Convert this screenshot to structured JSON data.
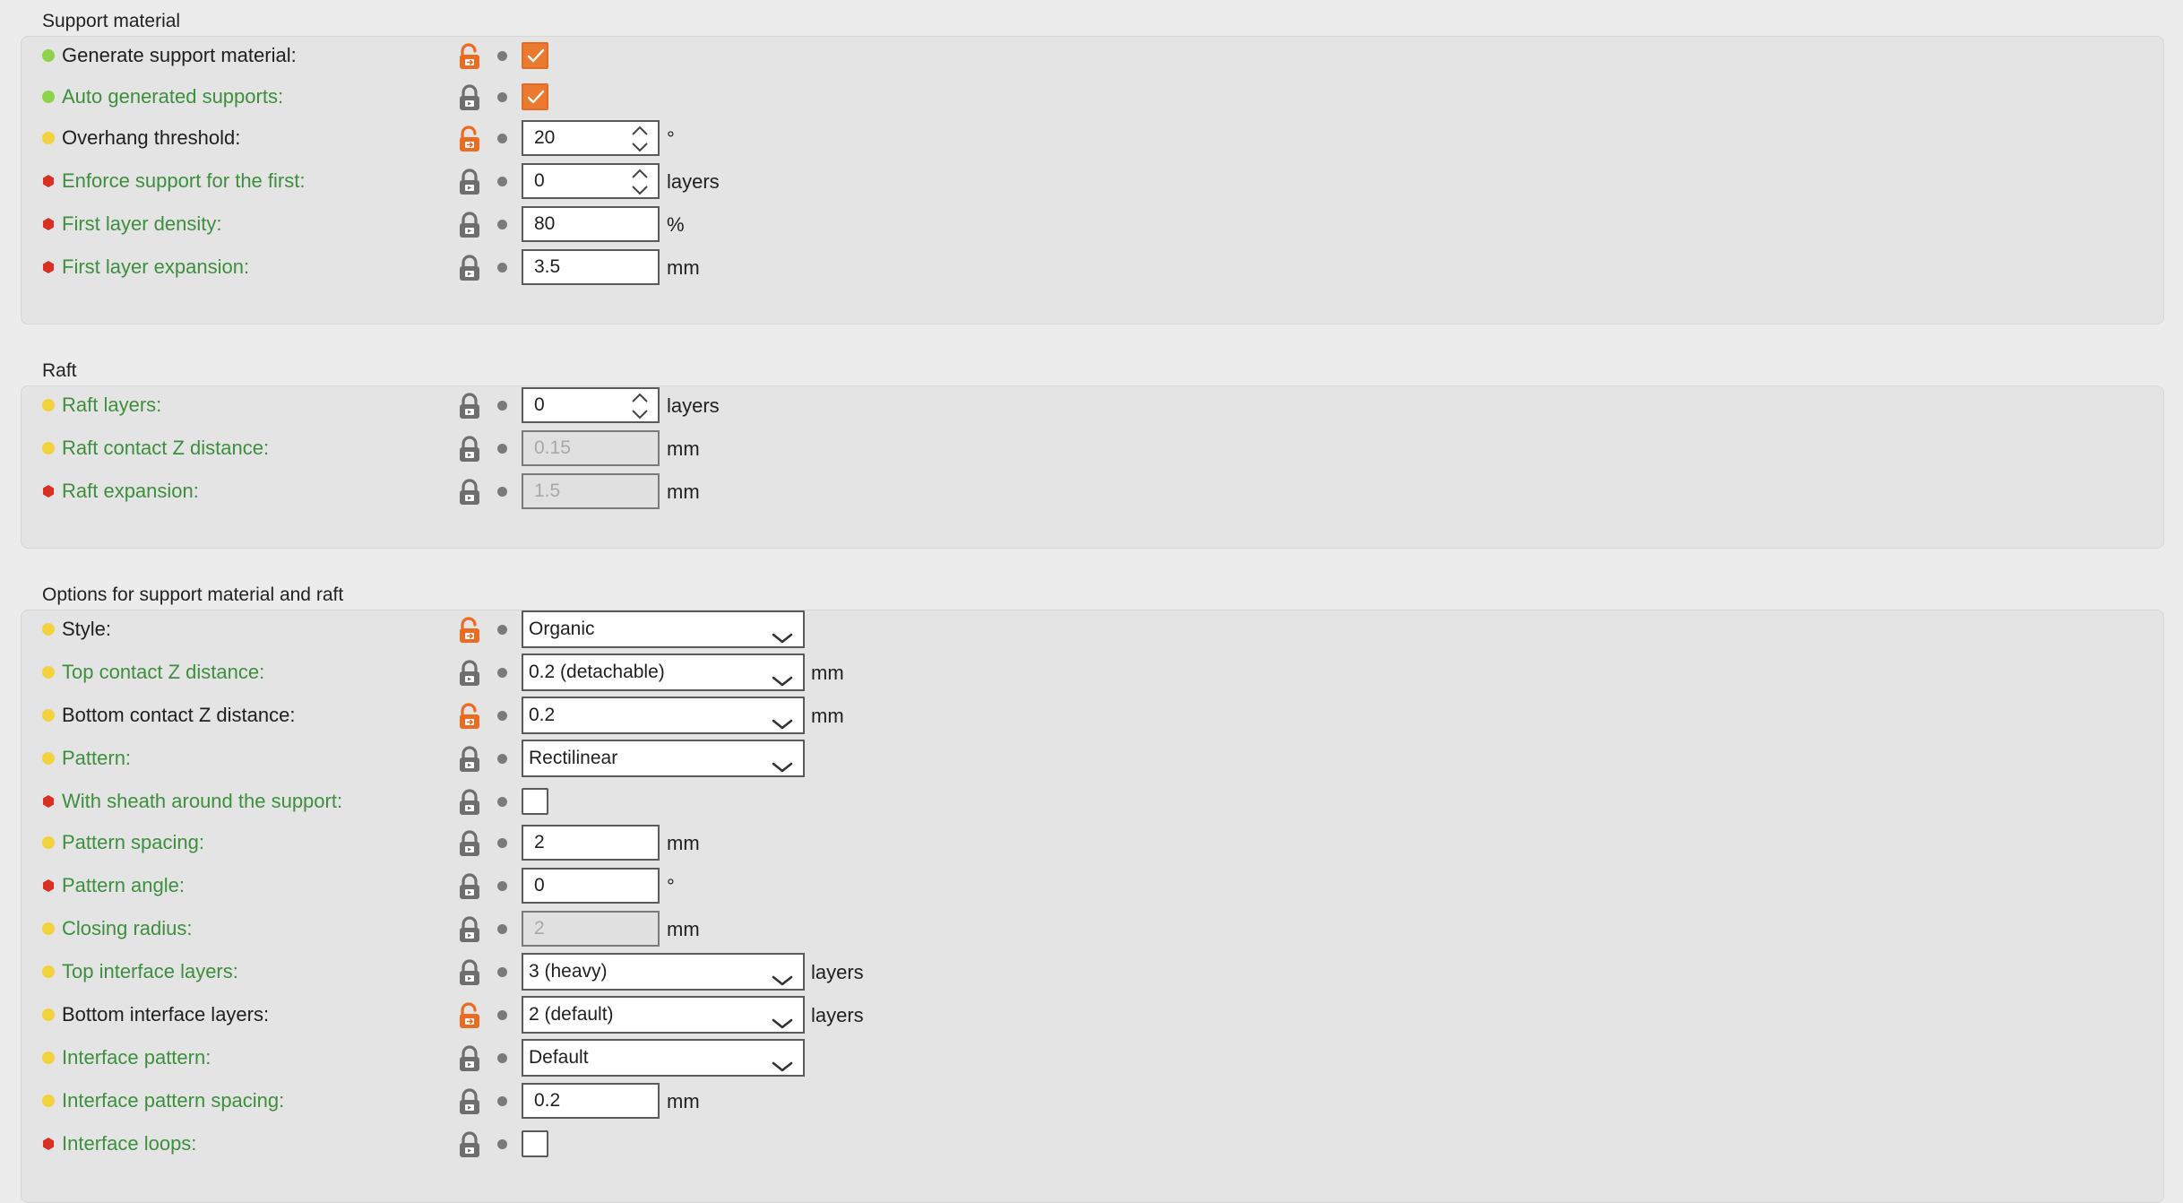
{
  "colors": {
    "accent": "#ea7a30",
    "mode_simple": "#8dd44a",
    "mode_advanced": "#f2d23d",
    "mode_expert": "#d93024",
    "system_value_label": "#3d8f3d"
  },
  "groups": [
    {
      "title": "Support material",
      "rows": [
        {
          "label": "Generate support material:",
          "mode": "simple",
          "lock": "unlocked-lock-icon",
          "control": "checkbox",
          "checked": true
        },
        {
          "label": "Auto generated supports:",
          "mode": "simple",
          "lock": "locked-lock-icon",
          "control": "checkbox",
          "checked": true
        },
        {
          "label": "Overhang threshold:",
          "mode": "advanced",
          "lock": "unlocked-lock-icon",
          "control": "spin",
          "value": "20",
          "unit": "°"
        },
        {
          "label": "Enforce support for the first:",
          "mode": "expert",
          "lock": "locked-lock-icon",
          "control": "spin",
          "value": "0",
          "unit": "layers"
        },
        {
          "label": "First layer density:",
          "mode": "expert",
          "lock": "locked-lock-icon",
          "control": "text",
          "value": "80",
          "unit": "%"
        },
        {
          "label": "First layer expansion:",
          "mode": "expert",
          "lock": "locked-lock-icon",
          "control": "text",
          "value": "3.5",
          "unit": "mm"
        }
      ]
    },
    {
      "title": "Raft",
      "rows": [
        {
          "label": "Raft layers:",
          "mode": "advanced",
          "lock": "locked-lock-icon",
          "control": "spin",
          "value": "0",
          "unit": "layers"
        },
        {
          "label": "Raft contact Z distance:",
          "mode": "advanced",
          "lock": "locked-lock-icon",
          "control": "text",
          "value": "0.15",
          "unit": "mm",
          "disabled": true
        },
        {
          "label": "Raft expansion:",
          "mode": "expert",
          "lock": "locked-lock-icon",
          "control": "text",
          "value": "1.5",
          "unit": "mm",
          "disabled": true
        }
      ]
    },
    {
      "title": "Options for support material and raft",
      "rows": [
        {
          "label": "Style:",
          "mode": "advanced",
          "lock": "unlocked-lock-icon",
          "control": "select",
          "value": "Organic"
        },
        {
          "label": "Top contact Z distance:",
          "mode": "advanced",
          "lock": "locked-lock-icon",
          "control": "select",
          "value": "0.2 (detachable)",
          "unit": "mm"
        },
        {
          "label": "Bottom contact Z distance:",
          "mode": "advanced",
          "lock": "unlocked-lock-icon",
          "control": "select",
          "value": "0.2",
          "unit": "mm"
        },
        {
          "label": "Pattern:",
          "mode": "advanced",
          "lock": "locked-lock-icon",
          "control": "select",
          "value": "Rectilinear"
        },
        {
          "label": "With sheath around the support:",
          "mode": "expert",
          "lock": "locked-lock-icon",
          "control": "checkbox",
          "checked": false
        },
        {
          "label": "Pattern spacing:",
          "mode": "advanced",
          "lock": "locked-lock-icon",
          "control": "text",
          "value": "2",
          "unit": "mm"
        },
        {
          "label": "Pattern angle:",
          "mode": "expert",
          "lock": "locked-lock-icon",
          "control": "text",
          "value": "0",
          "unit": "°"
        },
        {
          "label": "Closing radius:",
          "mode": "advanced",
          "lock": "locked-lock-icon",
          "control": "text",
          "value": "2",
          "unit": "mm",
          "disabled": true
        },
        {
          "label": "Top interface layers:",
          "mode": "advanced",
          "lock": "locked-lock-icon",
          "control": "select",
          "value": "3 (heavy)",
          "unit": "layers"
        },
        {
          "label": "Bottom interface layers:",
          "mode": "advanced",
          "lock": "unlocked-lock-icon",
          "control": "select",
          "value": "2 (default)",
          "unit": "layers"
        },
        {
          "label": "Interface pattern:",
          "mode": "advanced",
          "lock": "locked-lock-icon",
          "control": "select",
          "value": "Default"
        },
        {
          "label": "Interface pattern spacing:",
          "mode": "advanced",
          "lock": "locked-lock-icon",
          "control": "text",
          "value": "0.2",
          "unit": "mm"
        },
        {
          "label": "Interface loops:",
          "mode": "expert",
          "lock": "locked-lock-icon",
          "control": "checkbox",
          "checked": false
        }
      ]
    }
  ]
}
